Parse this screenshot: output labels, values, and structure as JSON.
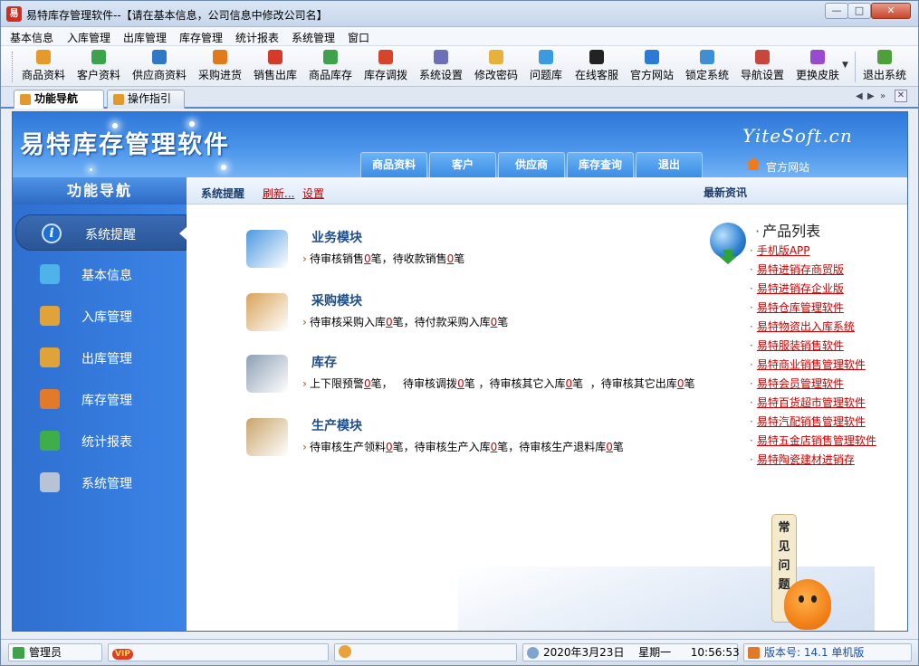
{
  "window": {
    "title": "易特库存管理软件--【请在基本信息，公司信息中修改公司名】",
    "app_icon_text": "易",
    "buttons": {
      "minimize": "—",
      "maximize": "□",
      "close": "✕"
    }
  },
  "menu": [
    "基本信息",
    "入库管理",
    "出库管理",
    "库存管理",
    "统计报表",
    "系统管理",
    "窗口"
  ],
  "toolbar": [
    {
      "label": "商品资料",
      "icon": "product-icon",
      "color": "#e39a2a"
    },
    {
      "label": "客户资料",
      "icon": "customer-icon",
      "color": "#3da34a"
    },
    {
      "label": "供应商资料",
      "icon": "supplier-icon",
      "color": "#2f78c8"
    },
    {
      "label": "采购进货",
      "icon": "purchase-icon",
      "color": "#e07a1a"
    },
    {
      "label": "销售出库",
      "icon": "sales-icon",
      "color": "#d63a2a"
    },
    {
      "label": "商品库存",
      "icon": "stock-icon",
      "color": "#3fa24a"
    },
    {
      "label": "库存调拨",
      "icon": "transfer-icon",
      "color": "#d6452a"
    },
    {
      "label": "系统设置",
      "icon": "settings-icon",
      "color": "#6d6fb8"
    },
    {
      "label": "修改密码",
      "icon": "password-icon",
      "color": "#e7b23c"
    },
    {
      "label": "问题库",
      "icon": "faq-icon",
      "color": "#3b9be0"
    },
    {
      "label": "在线客服",
      "icon": "qq-icon",
      "color": "#222222"
    },
    {
      "label": "官方网站",
      "icon": "ie-icon",
      "color": "#2a7ad6"
    },
    {
      "label": "锁定系统",
      "icon": "lock-icon",
      "color": "#3e8fd6"
    },
    {
      "label": "导航设置",
      "icon": "navigation-icon",
      "color": "#c9473a"
    },
    {
      "label": "更换皮肤",
      "icon": "skin-icon",
      "color": "#9a4ad0"
    },
    {
      "label": "退出系统",
      "icon": "exit-icon",
      "color": "#4f9f3a"
    }
  ],
  "tabs": [
    {
      "label": "功能导航",
      "active": true
    },
    {
      "label": "操作指引",
      "active": false
    }
  ],
  "tab_controls": [
    "◀",
    "▶",
    "»",
    "✕"
  ],
  "header": {
    "logo": "易特库存管理软件",
    "brand": "YiteSoft.cn",
    "tabs": [
      "商品资料",
      "客户",
      "供应商",
      "库存查询",
      "退出"
    ],
    "home_link": "官方网站"
  },
  "sidebar": {
    "title": "功能导航",
    "items": [
      {
        "label": "系统提醒",
        "icon": "info-icon",
        "color": "#1f6ed2",
        "active": true
      },
      {
        "label": "基本信息",
        "icon": "cubes-icon",
        "color": "#4fb2e8"
      },
      {
        "label": "入库管理",
        "icon": "inbound-box-icon",
        "color": "#e0a33a"
      },
      {
        "label": "出库管理",
        "icon": "outbound-box-icon",
        "color": "#e0a33a"
      },
      {
        "label": "库存管理",
        "icon": "warehouse-icon",
        "color": "#e27a2a"
      },
      {
        "label": "统计报表",
        "icon": "bar-chart-icon",
        "color": "#3fae4a"
      },
      {
        "label": "系统管理",
        "icon": "tools-icon",
        "color": "#b8c4d6"
      }
    ]
  },
  "content": {
    "bar_title": "系统提醒",
    "refresh": "刷新...",
    "settings": "设置",
    "news_title": "最新资讯",
    "modules": [
      {
        "title": "业务模块",
        "icon": "folder-icon",
        "color": "#4b98e0",
        "parts": [
          {
            "t": "待审核销售"
          },
          {
            "n": "0"
          },
          {
            "t": "笔，待收款销售"
          },
          {
            "n": "0"
          },
          {
            "t": "笔"
          }
        ]
      },
      {
        "title": "采购模块",
        "icon": "box-arrow-icon",
        "color": "#d9a35a",
        "parts": [
          {
            "t": "待审核采购入库"
          },
          {
            "n": "0"
          },
          {
            "t": "笔，待付款采购入库"
          },
          {
            "n": "0"
          },
          {
            "t": "笔"
          }
        ]
      },
      {
        "title": "库存",
        "icon": "database-icon",
        "color": "#8ea0b4",
        "parts": [
          {
            "t": "上下限预警"
          },
          {
            "n": "0"
          },
          {
            "t": "笔，   待审核调拨"
          },
          {
            "n": "0"
          },
          {
            "t": "笔 ，待审核其它入库"
          },
          {
            "n": "0"
          },
          {
            "t": "笔  ，待审核其它出库"
          },
          {
            "n": "0"
          },
          {
            "t": "笔"
          }
        ]
      },
      {
        "title": "生产模块",
        "icon": "clipboard-icon",
        "color": "#c9a46a",
        "parts": [
          {
            "t": "待审核生产领料"
          },
          {
            "n": "0"
          },
          {
            "t": "笔，待审核生产入库"
          },
          {
            "n": "0"
          },
          {
            "t": "笔，待审核生产退料库"
          },
          {
            "n": "0"
          },
          {
            "t": "笔"
          }
        ]
      }
    ],
    "products_title": "产品列表",
    "products": [
      "手机版APP",
      "易特进销存商贸版",
      "易特进销存企业版",
      "易特仓库管理软件",
      "易特物资出入库系统",
      "易特服装销售软件",
      "易特商业销售管理软件",
      "易特会员管理软件",
      "易特百货超市管理软件",
      "易特汽配销售管理软件",
      "易特五金店销售管理软件",
      "易特陶瓷建材进销存"
    ],
    "faq": [
      "常",
      "见",
      "问",
      "题"
    ]
  },
  "status": {
    "user": "管理员",
    "vip": "VIP",
    "date": "2020年3月23日",
    "weekday": "星期一",
    "time": "10:56:53",
    "version": "版本号: 14.1 单机版"
  }
}
